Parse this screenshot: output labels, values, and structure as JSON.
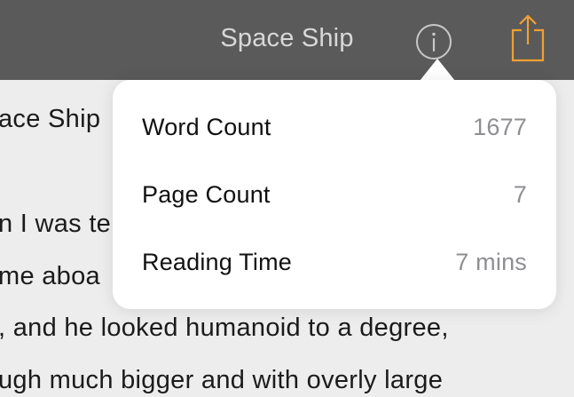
{
  "navbar": {
    "title": "Space Ship",
    "info_icon": "info-circle-icon",
    "share_icon": "share-icon",
    "accent_color": "#f0a033"
  },
  "document": {
    "lines": [
      "ace Ship",
      "n I was te",
      "me aboa",
      ", and he looked humanoid to a degree,",
      "ugh much bigger and with overly large"
    ]
  },
  "popover": {
    "stats": [
      {
        "label": "Word Count",
        "value": "1677"
      },
      {
        "label": "Page Count",
        "value": "7"
      },
      {
        "label": "Reading Time",
        "value": "7 mins"
      }
    ]
  }
}
